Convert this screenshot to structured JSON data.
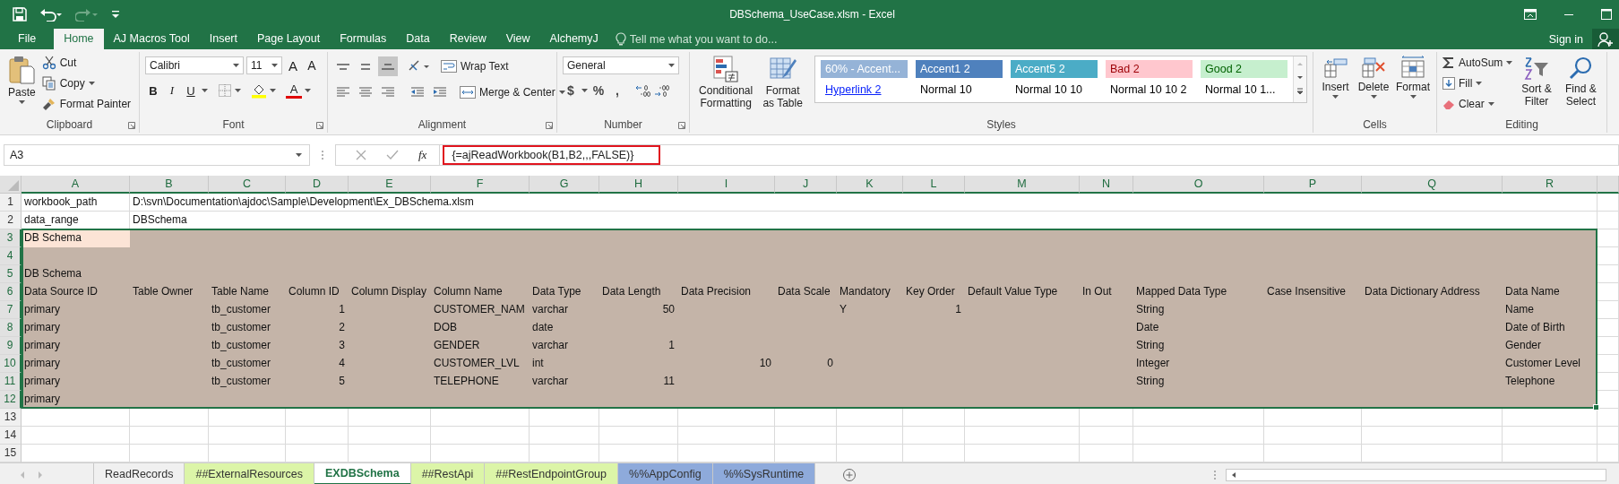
{
  "window": {
    "title": "DBSchema_UseCase.xlsm - Excel"
  },
  "tabs": [
    {
      "label": "File",
      "selected": false
    },
    {
      "label": "Home",
      "selected": true
    },
    {
      "label": "AJ Macros Tool",
      "selected": false
    },
    {
      "label": "Insert",
      "selected": false
    },
    {
      "label": "Page Layout",
      "selected": false
    },
    {
      "label": "Formulas",
      "selected": false
    },
    {
      "label": "Data",
      "selected": false
    },
    {
      "label": "Review",
      "selected": false
    },
    {
      "label": "View",
      "selected": false
    },
    {
      "label": "AlchemyJ",
      "selected": false
    }
  ],
  "tell_me": {
    "placeholder": "Tell me what you want to do..."
  },
  "sign_in": "Sign in",
  "clipboard": {
    "label": "Clipboard",
    "paste": "Paste",
    "cut": "Cut",
    "copy": "Copy",
    "format_painter": "Format Painter"
  },
  "font": {
    "label": "Font",
    "name": "Calibri",
    "size": "11",
    "grow": "A",
    "shrink": "A",
    "bold": "B",
    "italic": "I",
    "underline": "U",
    "font_color": "A"
  },
  "alignment": {
    "label": "Alignment",
    "wrap_text": "Wrap Text",
    "merge_center": "Merge & Center",
    "vertical": [
      {
        "selected": false
      },
      {
        "selected": false
      },
      {
        "selected": true
      }
    ]
  },
  "number": {
    "label": "Number",
    "format": "General",
    "currency": "$",
    "percent": "%",
    "comma": ","
  },
  "styles": {
    "label": "Styles",
    "conditional_formatting": "Conditional Formatting",
    "format_as_table": "Format as Table",
    "gallery": [
      {
        "label": "60% - Accent...",
        "kind": "accent",
        "color": "#95b3d7"
      },
      {
        "label": "Accent1 2",
        "kind": "accent",
        "color": "#4f81bd"
      },
      {
        "label": "Accent5 2",
        "kind": "accent",
        "color": "#4bacc6"
      },
      {
        "label": "Bad 2",
        "kind": "bad",
        "color": "#ffc7ce"
      },
      {
        "label": "Good 2",
        "kind": "good",
        "color": "#c6efce"
      },
      {
        "label": "Hyperlink 2",
        "kind": "link"
      },
      {
        "label": "Normal 10",
        "kind": "plain"
      },
      {
        "label": "Normal 10 10",
        "kind": "plain"
      },
      {
        "label": "Normal 10 10 2",
        "kind": "plain"
      },
      {
        "label": "Normal 10 1...",
        "kind": "plain"
      }
    ]
  },
  "cells": {
    "label": "Cells",
    "insert": "Insert",
    "delete": "Delete",
    "format": "Format"
  },
  "editing": {
    "label": "Editing",
    "autosum": "AutoSum",
    "fill": "Fill",
    "clear": "Clear",
    "sort_filter": "Sort & Filter",
    "find_select": "Find & Select"
  },
  "formula_bar": {
    "name_box": "A3",
    "function_label": "fx",
    "formula": "{=ajReadWorkbook(B1,B2,,,FALSE)}"
  },
  "sheet": {
    "columns": [
      "A",
      "B",
      "C",
      "D",
      "E",
      "F",
      "G",
      "H",
      "I",
      "J",
      "K",
      "L",
      "M",
      "N",
      "O",
      "P",
      "Q",
      "R"
    ],
    "rows": [
      {
        "number": "1",
        "shaded": false,
        "cells": [
          {
            "text": "workbook_path",
            "kind": "text",
            "selected": false
          },
          {
            "text": "D:\\svn\\Documentation\\ajdoc\\Sample\\Development\\Ex_DBSchema.xlsm",
            "kind": "text",
            "selected": false
          }
        ]
      },
      {
        "number": "2",
        "shaded": false,
        "cells": [
          {
            "text": "data_range",
            "kind": "text",
            "selected": false
          },
          {
            "text": "DBSchema",
            "kind": "text",
            "selected": false
          }
        ]
      },
      {
        "number": "3",
        "shaded": true,
        "cells": [
          {
            "text": "DB Schema",
            "kind": "text",
            "selected": true
          }
        ]
      },
      {
        "number": "4",
        "shaded": true,
        "cells": []
      },
      {
        "number": "5",
        "shaded": true,
        "cells": [
          {
            "text": "DB Schema",
            "kind": "text",
            "selected": false
          }
        ]
      },
      {
        "number": "6",
        "shaded": true,
        "cells": [
          {
            "text": "Data Source ID",
            "kind": "text",
            "selected": false
          },
          {
            "text": "Table Owner",
            "kind": "text",
            "selected": false
          },
          {
            "text": "Table Name",
            "kind": "text",
            "selected": false
          },
          {
            "text": "Column ID",
            "kind": "text",
            "selected": false
          },
          {
            "text": "Column Display",
            "kind": "text",
            "selected": false
          },
          {
            "text": "Column Name",
            "kind": "text",
            "selected": false
          },
          {
            "text": "Data Type",
            "kind": "text",
            "selected": false
          },
          {
            "text": "Data Length",
            "kind": "text",
            "selected": false
          },
          {
            "text": "Data Precision",
            "kind": "text",
            "selected": false
          },
          {
            "text": "Data Scale",
            "kind": "text",
            "selected": false
          },
          {
            "text": "Mandatory",
            "kind": "text",
            "selected": false
          },
          {
            "text": "Key Order",
            "kind": "text",
            "selected": false
          },
          {
            "text": "Default Value Type",
            "kind": "text",
            "selected": false
          },
          {
            "text": "In Out",
            "kind": "text",
            "selected": false
          },
          {
            "text": "Mapped Data Type",
            "kind": "text",
            "selected": false
          },
          {
            "text": "Case Insensitive",
            "kind": "text",
            "selected": false
          },
          {
            "text": "Data Dictionary Address",
            "kind": "text",
            "selected": false
          },
          {
            "text": "Data Name",
            "kind": "text",
            "selected": false
          }
        ]
      },
      {
        "number": "7",
        "shaded": true,
        "cells": [
          {
            "text": "primary",
            "kind": "text",
            "selected": false
          },
          null,
          {
            "text": "tb_customer",
            "kind": "text",
            "selected": false
          },
          {
            "text": "1",
            "kind": "number",
            "selected": false
          },
          null,
          {
            "text": "CUSTOMER_NAM",
            "kind": "text",
            "selected": false
          },
          {
            "text": "varchar",
            "kind": "text",
            "selected": false
          },
          {
            "text": "50",
            "kind": "number",
            "selected": false
          },
          null,
          null,
          {
            "text": "Y",
            "kind": "text",
            "selected": false
          },
          {
            "text": "1",
            "kind": "number",
            "selected": false
          },
          null,
          null,
          {
            "text": "String",
            "kind": "text",
            "selected": false
          },
          null,
          null,
          {
            "text": "Name",
            "kind": "text",
            "selected": false
          }
        ]
      },
      {
        "number": "8",
        "shaded": true,
        "cells": [
          {
            "text": "primary",
            "kind": "text",
            "selected": false
          },
          null,
          {
            "text": "tb_customer",
            "kind": "text",
            "selected": false
          },
          {
            "text": "2",
            "kind": "number",
            "selected": false
          },
          null,
          {
            "text": "DOB",
            "kind": "text",
            "selected": false
          },
          {
            "text": "date",
            "kind": "text",
            "selected": false
          },
          null,
          null,
          null,
          null,
          null,
          null,
          null,
          {
            "text": "Date",
            "kind": "text",
            "selected": false
          },
          null,
          null,
          {
            "text": "Date of Birth",
            "kind": "text",
            "selected": false
          }
        ]
      },
      {
        "number": "9",
        "shaded": true,
        "cells": [
          {
            "text": "primary",
            "kind": "text",
            "selected": false
          },
          null,
          {
            "text": "tb_customer",
            "kind": "text",
            "selected": false
          },
          {
            "text": "3",
            "kind": "number",
            "selected": false
          },
          null,
          {
            "text": "GENDER",
            "kind": "text",
            "selected": false
          },
          {
            "text": "varchar",
            "kind": "text",
            "selected": false
          },
          {
            "text": "1",
            "kind": "number",
            "selected": false
          },
          null,
          null,
          null,
          null,
          null,
          null,
          {
            "text": "String",
            "kind": "text",
            "selected": false
          },
          null,
          null,
          {
            "text": "Gender",
            "kind": "text",
            "selected": false
          }
        ]
      },
      {
        "number": "10",
        "shaded": true,
        "cells": [
          {
            "text": "primary",
            "kind": "text",
            "selected": false
          },
          null,
          {
            "text": "tb_customer",
            "kind": "text",
            "selected": false
          },
          {
            "text": "4",
            "kind": "number",
            "selected": false
          },
          null,
          {
            "text": "CUSTOMER_LVL",
            "kind": "text",
            "selected": false
          },
          {
            "text": "int",
            "kind": "text",
            "selected": false
          },
          null,
          {
            "text": "10",
            "kind": "number",
            "selected": false
          },
          {
            "text": "0",
            "kind": "number",
            "selected": false
          },
          null,
          null,
          null,
          null,
          {
            "text": "Integer",
            "kind": "text",
            "selected": false
          },
          null,
          null,
          {
            "text": "Customer Level",
            "kind": "text",
            "selected": false
          }
        ]
      },
      {
        "number": "11",
        "shaded": true,
        "cells": [
          {
            "text": "primary",
            "kind": "text",
            "selected": false
          },
          null,
          {
            "text": "tb_customer",
            "kind": "text",
            "selected": false
          },
          {
            "text": "5",
            "kind": "number",
            "selected": false
          },
          null,
          {
            "text": "TELEPHONE",
            "kind": "text",
            "selected": false
          },
          {
            "text": "varchar",
            "kind": "text",
            "selected": false
          },
          {
            "text": "11",
            "kind": "number",
            "selected": false
          },
          null,
          null,
          null,
          null,
          null,
          null,
          {
            "text": "String",
            "kind": "text",
            "selected": false
          },
          null,
          null,
          {
            "text": "Telephone",
            "kind": "text",
            "selected": false
          }
        ]
      },
      {
        "number": "12",
        "shaded": true,
        "cells": [
          {
            "text": "primary",
            "kind": "text",
            "selected": false
          }
        ]
      },
      {
        "number": "13",
        "shaded": false,
        "cells": []
      },
      {
        "number": "14",
        "shaded": false,
        "cells": []
      },
      {
        "number": "15",
        "shaded": false,
        "cells": []
      }
    ]
  },
  "sheet_tabs": [
    {
      "label": "ReadRecords",
      "selected": false
    },
    {
      "label": "##ExternalResources",
      "selected": false,
      "color": "#dcf5a8"
    },
    {
      "label": "EXDBSchema",
      "selected": true
    },
    {
      "label": "##RestApi",
      "selected": false,
      "color": "#dcf5a8"
    },
    {
      "label": "##RestEndpointGroup",
      "selected": false,
      "color": "#dcf5a8"
    },
    {
      "label": "%%AppConfig",
      "selected": false,
      "color": "#8eaadb"
    },
    {
      "label": "%%SysRuntime",
      "selected": false,
      "color": "#8eaadb"
    }
  ]
}
